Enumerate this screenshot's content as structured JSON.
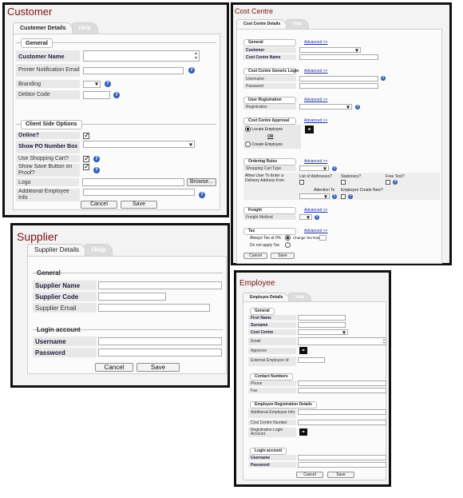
{
  "customer": {
    "title": "Customer",
    "tabs": [
      "Customer Details",
      "Help"
    ],
    "general_header": "General",
    "rows": [
      {
        "label": "Customer Name",
        "bold": true
      },
      {
        "label": "Printer Notification Email"
      },
      {
        "label": "Branding"
      },
      {
        "label": "Debtor Code"
      }
    ],
    "client_header": "Client Side Options",
    "client_rows": [
      {
        "label": "Online?"
      },
      {
        "label": "Show PO Number Box"
      },
      {
        "label": "Use Shopping Cart?"
      },
      {
        "label": "Show Save Button on Proof?"
      },
      {
        "label": "Logo"
      },
      {
        "label": "Additional Employee Info"
      }
    ],
    "browse_label": "Browse...",
    "cancel_label": "Cancel",
    "save_label": "Save"
  },
  "cost_centre": {
    "title": "Cost Centre",
    "tabs": [
      "Cost Centre Details",
      "Help"
    ],
    "advanced": "Advanced >>",
    "general_header": "General",
    "general_rows": [
      "Customer",
      "Cost Centre Name"
    ],
    "login_header": "Cost Centre Generic Login",
    "login_rows": [
      "Username",
      "Password"
    ],
    "reg_header": "User Registration",
    "reg_rows": [
      "Registration"
    ],
    "approval_header": "Cost Centre Approval",
    "locate_employee": "Locate Employee",
    "or_label": "OR",
    "create_employee": "Create Employee",
    "ordering_header": "Ordering Rules",
    "shopping_cart_type": "Shopping Cart Type",
    "allow_delivery": "Allow User To Enter a Delivery Address from",
    "list_of_addresses": "List of Addresses?",
    "stationery": "Stationery?",
    "free_text": "Free Text?",
    "attention_to": "Attention To",
    "employee_create_new": "Employee Create New?",
    "freight_header": "Freight",
    "freight_method": "Freight Method",
    "tax_header": "Tax",
    "always_tax": "Always Tax at 0%",
    "do_not_apply_tax": "Do not apply Tax",
    "change_tax_rate": "Change Tax Rate",
    "cancel_label": "Cancel",
    "save_label": "Save"
  },
  "supplier": {
    "title": "Supplier",
    "tabs": [
      "Supplier Details",
      "Help"
    ],
    "general_header": "General",
    "rows": [
      "Supplier Name",
      "Supplier Code",
      "Supplier Email"
    ],
    "login_header": "Login account",
    "login_rows": [
      "Username",
      "Password"
    ],
    "cancel_label": "Cancel",
    "save_label": "Save"
  },
  "employee": {
    "title": "Employee",
    "tabs": [
      "Employee Details",
      "Help"
    ],
    "general_header": "General",
    "general_rows": [
      "First Name",
      "Surname",
      "Cost Centre",
      "Email",
      "Approver",
      "External Employee Id"
    ],
    "contact_header": "Contact Numbers",
    "contact_rows": [
      "Phone",
      "Fax"
    ],
    "reg_header": "Employee Registration Details",
    "reg_rows": [
      "Additional Employee Info",
      "Cost Centre Number",
      "Registration Login Account"
    ],
    "login_header": "Login account",
    "login_rows": [
      "Username",
      "Password"
    ],
    "cancel_label": "Cancel",
    "save_label": "Save"
  }
}
